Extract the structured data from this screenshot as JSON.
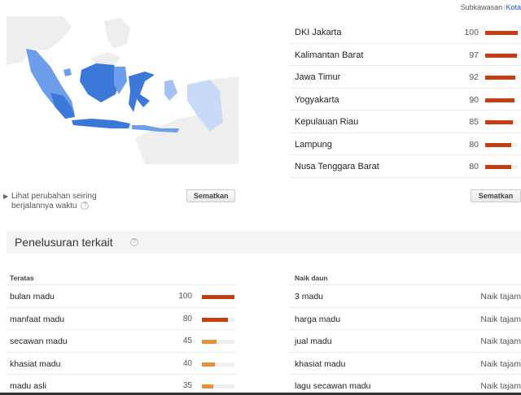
{
  "view_toggle": {
    "subregion": "Subkawasan",
    "city": "Kota"
  },
  "map": {
    "name": "Indonesia",
    "colors": {
      "high": "#3c78d8",
      "mid": "#6d9eeb",
      "low": "#a4c2f4",
      "lowest": "#c9daf8",
      "none": "#eeeeee"
    }
  },
  "regions": [
    {
      "name": "DKI Jakarta",
      "value": 100
    },
    {
      "name": "Kalimantan Barat",
      "value": 97
    },
    {
      "name": "Jawa Timur",
      "value": 92
    },
    {
      "name": "Yogyakarta",
      "value": 90
    },
    {
      "name": "Kepulauan Riau",
      "value": 85
    },
    {
      "name": "Lampung",
      "value": 80
    },
    {
      "name": "Nusa Tenggara Barat",
      "value": 80
    }
  ],
  "change_link": {
    "line1": "Lihat perubahan seiring",
    "line2": "berjalannya waktu"
  },
  "embed_button": "Sematkan",
  "related": {
    "title": "Penelusuran terkait"
  },
  "top": {
    "heading": "Teratas",
    "items": [
      {
        "label": "bulan madu",
        "value": 100,
        "color": "#c53d10"
      },
      {
        "label": "manfaat madu",
        "value": 80,
        "color": "#c53d10"
      },
      {
        "label": "secawan madu",
        "value": 45,
        "color": "#e69138"
      },
      {
        "label": "khasiat madu",
        "value": 40,
        "color": "#e69138"
      },
      {
        "label": "madu asli",
        "value": 35,
        "color": "#e69138"
      }
    ]
  },
  "rising": {
    "heading": "Naik daun",
    "items": [
      {
        "label": "3 madu",
        "status": "Naik tajam"
      },
      {
        "label": "harga madu",
        "status": "Naik tajam"
      },
      {
        "label": "jual madu",
        "status": "Naik tajam"
      },
      {
        "label": "khasiat madu",
        "status": "Naik tajam"
      },
      {
        "label": "lagu secawan madu",
        "status": "Naik tajam"
      }
    ]
  },
  "accent_colors": {
    "bar_strong": "#c53d10",
    "bar_light": "#e69138",
    "link": "#1155cc"
  }
}
